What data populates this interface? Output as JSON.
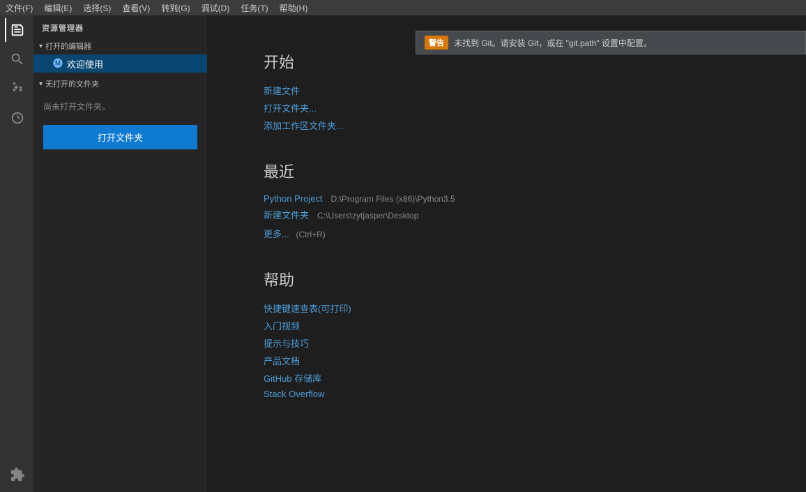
{
  "titlebar": {
    "menus": [
      "文件(F)",
      "编辑(E)",
      "选择(S)",
      "查看(V)",
      "转到(G)",
      "调试(D)",
      "任务(T)",
      "帮助(H)"
    ]
  },
  "sidebar": {
    "header": "资源管理器",
    "section_open_editors": "打开的编辑器",
    "welcome_tab": "欢迎使用",
    "section_no_folder": "无打开的文件夹",
    "no_folder_text": "尚未打开文件夹。",
    "open_folder_btn": "打开文件夹"
  },
  "notification": {
    "badge": "警告",
    "text": "未找到 Git。请安装 Git，或在 \"git.path\" 设置中配置。"
  },
  "welcome": {
    "start_heading": "开始",
    "links": [
      {
        "label": "新建文件",
        "id": "new-file"
      },
      {
        "label": "打开文件夹...",
        "id": "open-folder"
      },
      {
        "label": "添加工作区文件夹...",
        "id": "add-workspace"
      }
    ],
    "recent_heading": "最近",
    "recent_items": [
      {
        "name": "Python Project",
        "path": "D:\\Program Files (x86)\\Python3.5"
      },
      {
        "name": "新建文件夹",
        "path": "C:\\Users\\zytjasper\\Desktop"
      }
    ],
    "more_label": "更多...",
    "more_shortcut": "(Ctrl+R)",
    "help_heading": "帮助",
    "help_links": [
      {
        "label": "快捷键速查表(可打印)",
        "id": "shortcuts"
      },
      {
        "label": "入门视频",
        "id": "intro-videos"
      },
      {
        "label": "提示与技巧",
        "id": "tips"
      },
      {
        "label": "产品文档",
        "id": "docs"
      },
      {
        "label": "GitHub 存储库",
        "id": "github"
      },
      {
        "label": "Stack Overflow",
        "id": "stackoverflow"
      }
    ]
  },
  "activity_icons": [
    {
      "id": "files",
      "symbol": "⎘",
      "active": true
    },
    {
      "id": "search",
      "symbol": "🔍",
      "active": false
    },
    {
      "id": "git",
      "symbol": "⑂",
      "active": false
    },
    {
      "id": "debug",
      "symbol": "⬡",
      "active": false
    },
    {
      "id": "extensions",
      "symbol": "⊞",
      "active": false
    }
  ]
}
